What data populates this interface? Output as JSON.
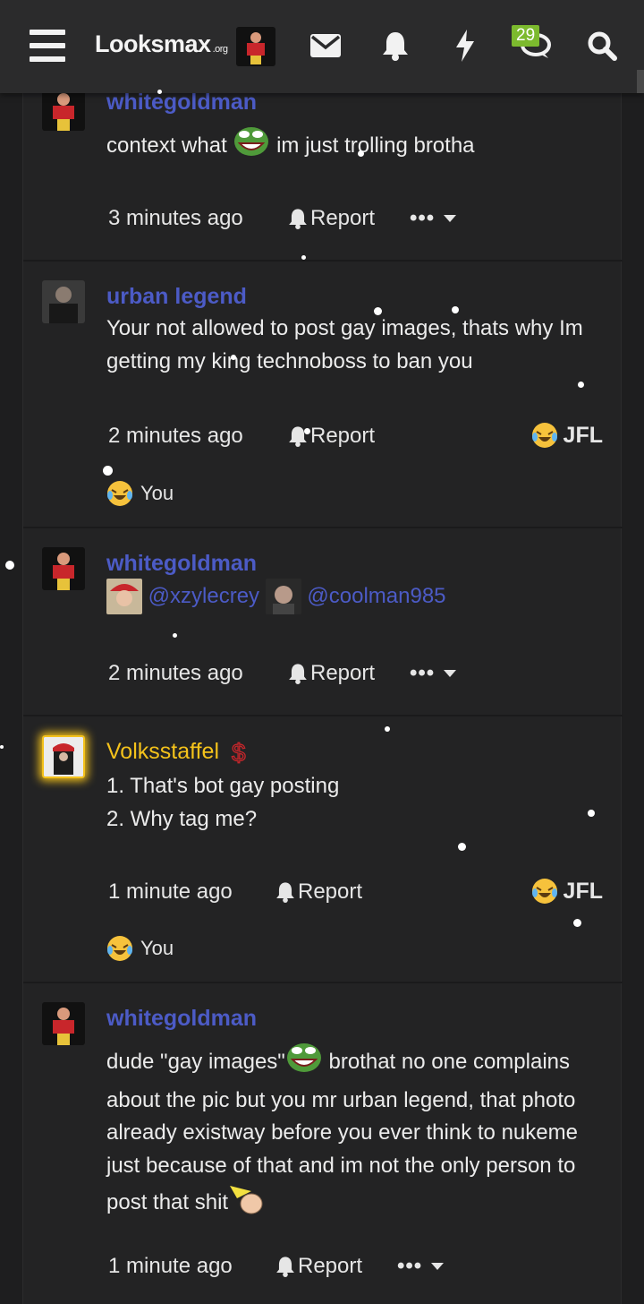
{
  "header": {
    "logo_text": "Looksmax",
    "logo_suffix": ".org",
    "chat_badge": "29",
    "icons": [
      "menu-icon",
      "envelope-icon",
      "bell-icon",
      "lightning-icon",
      "chat-icon",
      "search-icon"
    ]
  },
  "posts": [
    {
      "author": "whitegoldman",
      "text_before": "context what",
      "text_after": "im just trolling brotha",
      "time": "3 minutes ago",
      "report": "Report"
    },
    {
      "author": "urban legend",
      "text": "Your not allowed to post gay images, thats why Im getting my king technoboss to ban you",
      "time": "2 minutes ago",
      "report": "Report",
      "reaction_label": "JFL",
      "reactor": "You"
    },
    {
      "author": "whitegoldman",
      "mention_1": "@xzylecrey",
      "mention_2": "@coolman985",
      "time": "2 minutes ago",
      "report": "Report"
    },
    {
      "author": "Volksstaffel",
      "line_1": "1. That's bot gay posting",
      "line_2": "2. Why tag me?",
      "time": "1 minute ago",
      "report": "Report",
      "reaction_label": "JFL",
      "reactor": "You"
    },
    {
      "author": "whitegoldman",
      "text_before": "dude \"gay images\"",
      "text_after": "brothat no one complains about the pic but you mr urban legend, that photo already existway before you ever think to nukeme just because of that and im not the only person to post that shit",
      "time": "1 minute ago",
      "report": "Report"
    }
  ],
  "colors": {
    "username": "#4c5bc6",
    "gold_username": "#f4c21b",
    "badge": "#7cba2e",
    "background": "#1e1e1f"
  }
}
